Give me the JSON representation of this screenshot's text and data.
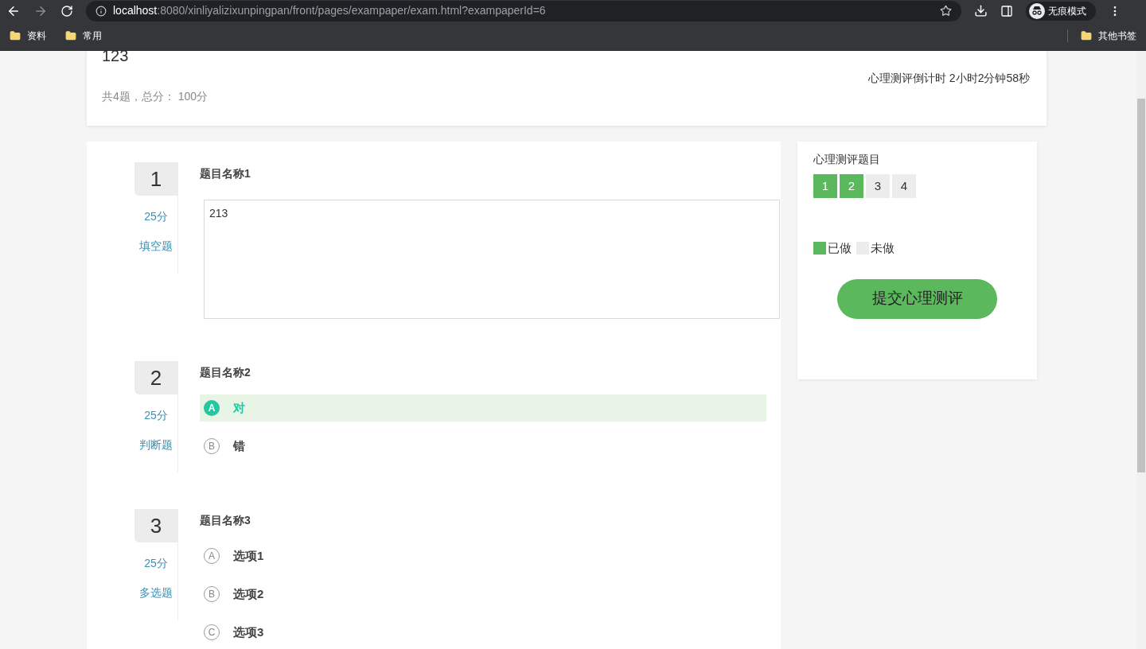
{
  "browser": {
    "url_host": "localhost",
    "url_rest": ":8080/xinliyalizixunpingpan/front/pages/exampaper/exam.html?exampaperId=6",
    "profile_label": "无痕模式",
    "bookmarks": [
      "资料",
      "常用"
    ],
    "other_bookmarks": "其他书签"
  },
  "exam": {
    "title": "123",
    "summary": "共4题，总分： 100分",
    "countdown": "心理测评倒计时 2小时2分钟58秒"
  },
  "questions": [
    {
      "number": "1",
      "score": "25分",
      "type_label": "填空题",
      "title": "题目名称1",
      "kind": "text",
      "answer": "213"
    },
    {
      "number": "2",
      "score": "25分",
      "type_label": "判断题",
      "title": "题目名称2",
      "kind": "choice",
      "options": [
        {
          "letter": "A",
          "text": "对",
          "selected": true
        },
        {
          "letter": "B",
          "text": "错",
          "selected": false
        }
      ]
    },
    {
      "number": "3",
      "score": "25分",
      "type_label": "多选题",
      "title": "题目名称3",
      "kind": "choice",
      "options": [
        {
          "letter": "A",
          "text": "选项1",
          "selected": false
        },
        {
          "letter": "B",
          "text": "选项2",
          "selected": false
        },
        {
          "letter": "C",
          "text": "选项3",
          "selected": false
        }
      ]
    }
  ],
  "nav": {
    "title": "心理测评题目",
    "items": [
      {
        "label": "1",
        "done": true
      },
      {
        "label": "2",
        "done": true
      },
      {
        "label": "3",
        "done": false
      },
      {
        "label": "4",
        "done": false
      }
    ],
    "legend": [
      {
        "label": "已做",
        "done": true
      },
      {
        "label": "未做",
        "done": false
      }
    ],
    "submit": "提交心理测评"
  }
}
